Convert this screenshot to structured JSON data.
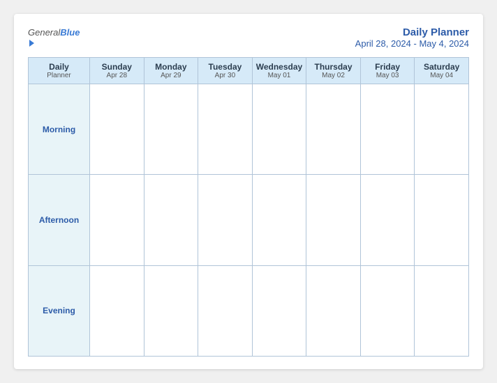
{
  "logo": {
    "general": "General",
    "blue": "Blue",
    "icon": "▶"
  },
  "title": {
    "main": "Daily Planner",
    "sub": "April 28, 2024 - May 4, 2024"
  },
  "table": {
    "header_col": {
      "line1": "Daily",
      "line2": "Planner"
    },
    "columns": [
      {
        "day": "Sunday",
        "date": "Apr 28"
      },
      {
        "day": "Monday",
        "date": "Apr 29"
      },
      {
        "day": "Tuesday",
        "date": "Apr 30"
      },
      {
        "day": "Wednesday",
        "date": "May 01"
      },
      {
        "day": "Thursday",
        "date": "May 02"
      },
      {
        "day": "Friday",
        "date": "May 03"
      },
      {
        "day": "Saturday",
        "date": "May 04"
      }
    ],
    "rows": [
      {
        "label": "Morning"
      },
      {
        "label": "Afternoon"
      },
      {
        "label": "Evening"
      }
    ]
  }
}
